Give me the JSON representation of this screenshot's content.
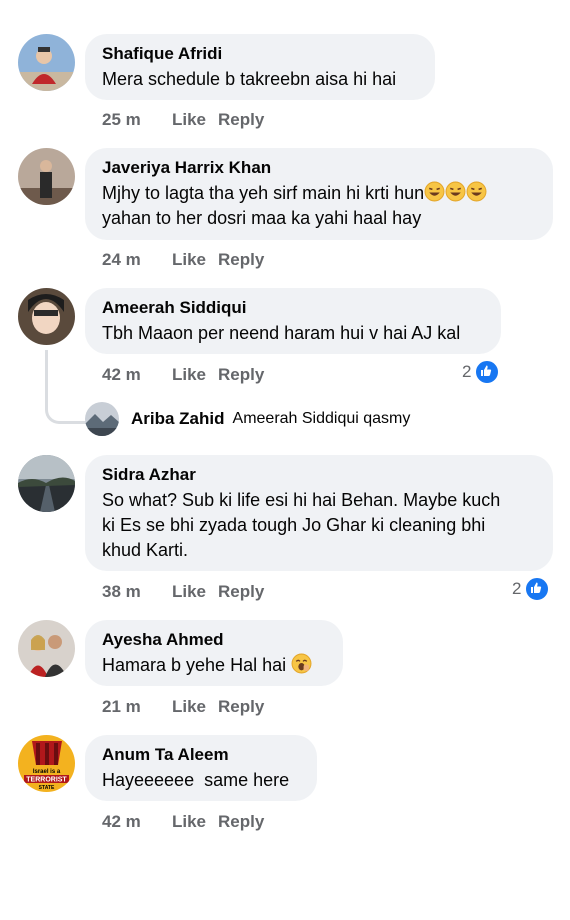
{
  "comments": [
    {
      "name": "Shafique Afridi",
      "text": [
        "Mera schedule b takreebn aisa hi hai"
      ],
      "time": "25 m",
      "like": "Like",
      "reply": "Reply"
    },
    {
      "name": "Javeriya Harrix Khan",
      "text": [
        "Mjhy to lagta tha yeh sirf main hi krti hun",
        "yahan to her dosri maa ka yahi haal hay"
      ],
      "time": "24 m",
      "like": "Like",
      "reply": "Reply"
    },
    {
      "name": "Ameerah Siddiqui",
      "text": [
        "Tbh Maaon per neend haram hui v hai AJ kal"
      ],
      "time": "42 m",
      "like": "Like",
      "reply": "Reply",
      "reaction_count": "2"
    },
    {
      "name": "Sidra Azhar",
      "text": [
        "So what? Sub ki life esi hi hai Behan. Maybe kuch",
        "ki Es se bhi zyada tough Jo Ghar ki cleaning bhi",
        "khud Karti."
      ],
      "time": "38 m",
      "like": "Like",
      "reply": "Reply",
      "reaction_count": "2"
    },
    {
      "name": "Ayesha Ahmed",
      "text": [
        "Hamara b yehe Hal hai"
      ],
      "time": "21 m",
      "like": "Like",
      "reply": "Reply"
    },
    {
      "name": "Anum Ta Aleem",
      "text": [
        "Hayeeeeee  same here"
      ],
      "time": "42 m",
      "like": "Like",
      "reply": "Reply"
    }
  ],
  "reply_preview": {
    "name": "Ariba Zahid",
    "text": "Ameerah Siddiqui qasmy"
  },
  "avatar_logo_text": [
    "Israel is a",
    "TERRORIST",
    "STATE"
  ],
  "icons": {
    "laugh": "rolling-laughing-emoji",
    "yawn": "yawning-emoji",
    "like": "thumbs-up-icon"
  },
  "colors": {
    "bubble": "#f0f2f5",
    "meta": "#65676b",
    "like_blue": "#1877f2",
    "text": "#050505"
  }
}
